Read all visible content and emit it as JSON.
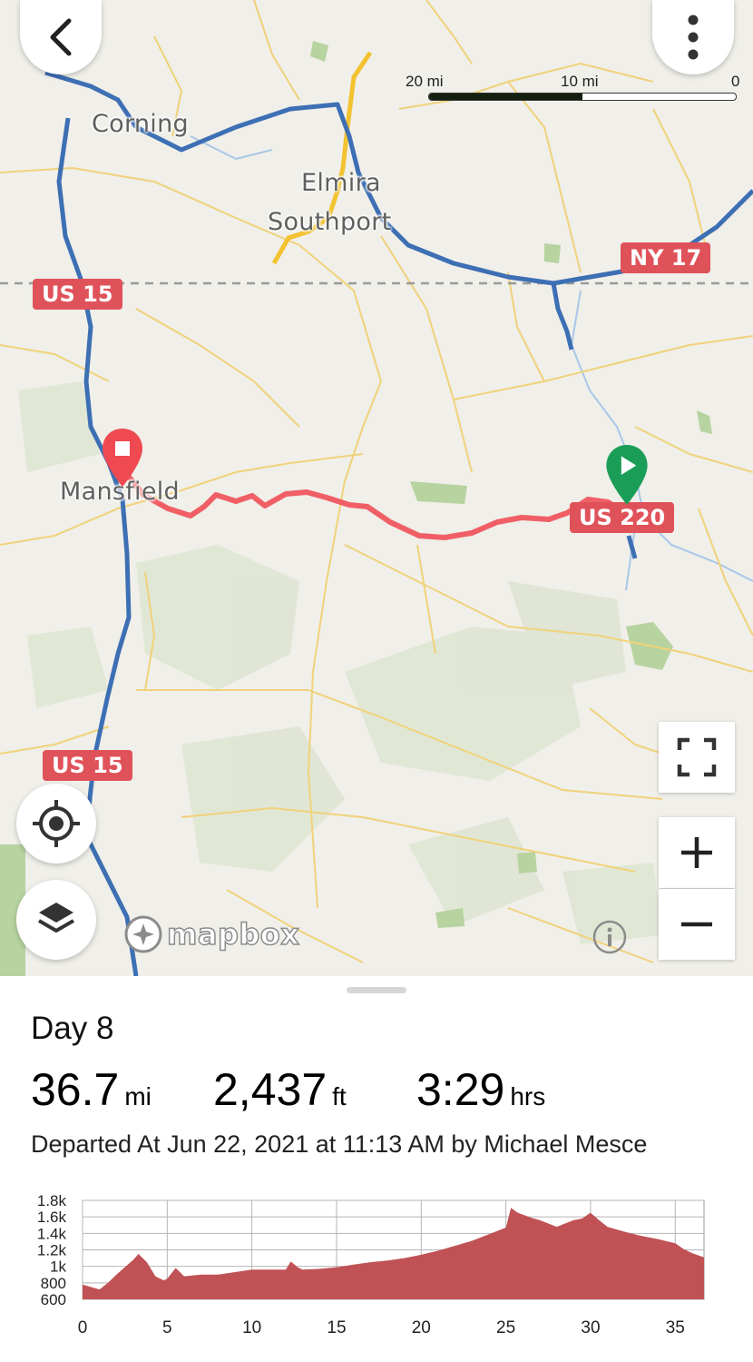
{
  "map": {
    "places": [
      "Corning",
      "Elmira",
      "Southport",
      "Mansfield"
    ],
    "shields": [
      "US 15",
      "NY 17",
      "US 220",
      "US 15"
    ],
    "scale": {
      "left": "20 mi",
      "mid": "10 mi",
      "right": "0"
    },
    "attribution": "mapbox",
    "icons": [
      "back-arrow-icon",
      "more-vertical-icon",
      "locate-icon",
      "layers-icon",
      "fullscreen-icon",
      "zoom-in-icon",
      "zoom-out-icon",
      "info-icon",
      "start-flag-icon",
      "end-stop-icon"
    ]
  },
  "trip": {
    "title": "Day 8",
    "distance": {
      "value": "36.7",
      "unit": "mi"
    },
    "elevation": {
      "value": "2,437",
      "unit": "ft"
    },
    "duration": {
      "value": "3:29",
      "unit": "hrs"
    },
    "departed": "Departed At Jun 22, 2021 at 11:13 AM by Michael Mesce"
  },
  "colors": {
    "route": "#f0525a",
    "start": "#1a9e57",
    "end": "#ef4a52",
    "highway": "#3d6fb4",
    "elevation_fill": "#c05255"
  },
  "chart_data": {
    "type": "area",
    "xlabel": "",
    "ylabel": "",
    "x_ticks": [
      "0",
      "5",
      "10",
      "15",
      "20",
      "25",
      "30",
      "35"
    ],
    "y_ticks": [
      "1.8k",
      "1.6k",
      "1.4k",
      "1.2k",
      "1k",
      "800",
      "600"
    ],
    "xlim": [
      0,
      36.7
    ],
    "ylim": [
      600,
      1800
    ],
    "series": [
      {
        "x": [
          0,
          1,
          1.5,
          2,
          3,
          3.3,
          3.8,
          4.3,
          4.8,
          5,
          5.5,
          6,
          7,
          8,
          9,
          10,
          11,
          12,
          12.3,
          12.7,
          13,
          14,
          15,
          16,
          17,
          18,
          19,
          20,
          21,
          22,
          23,
          24,
          25,
          25.3,
          25.7,
          26.5,
          27,
          28,
          29,
          29.5,
          30,
          30.5,
          31,
          32,
          33,
          34,
          35,
          35.5,
          36,
          36.7
        ],
        "y": [
          780,
          720,
          800,
          900,
          1080,
          1150,
          1050,
          880,
          830,
          850,
          980,
          880,
          900,
          900,
          930,
          960,
          960,
          960,
          1060,
          990,
          960,
          970,
          990,
          1020,
          1050,
          1070,
          1100,
          1140,
          1190,
          1250,
          1310,
          1390,
          1470,
          1710,
          1650,
          1590,
          1560,
          1480,
          1560,
          1580,
          1650,
          1560,
          1480,
          1420,
          1370,
          1330,
          1280,
          1210,
          1160,
          1110
        ]
      }
    ]
  }
}
